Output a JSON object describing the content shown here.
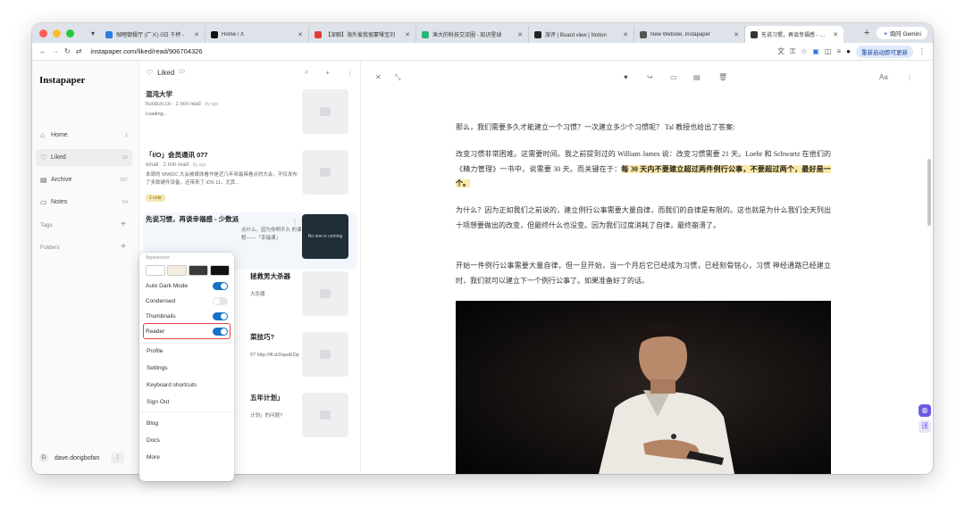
{
  "browser": {
    "tabs": [
      {
        "label": "咖哩御餐厅 (广ㄨ) 0日 千秤 -",
        "color": "#2a7de1"
      },
      {
        "label": "Home / X",
        "color": "#111111"
      },
      {
        "label": "【深聊】海外爱我很蒙嗓宝刘",
        "color": "#e23b3b"
      },
      {
        "label": "渔大的科技交流圈 - 知识星球",
        "color": "#2ab37a"
      },
      {
        "label": "旅评 | Board view | Notion",
        "color": "#222222"
      },
      {
        "label": "New Website, Instapaper",
        "color": "#555555"
      },
      {
        "label": "先说习惯，再谈幸福感 - 少数",
        "color": "#333333"
      }
    ],
    "active_tab": 6,
    "gemini_label": "询问 Gemini",
    "url": "instapaper.com/liked/read/906704326",
    "update_label": "重新启动即可更新"
  },
  "sidebar": {
    "brand": "Instapaper",
    "nav": [
      {
        "label": "Home",
        "count": "1",
        "icon": "house-icon"
      },
      {
        "label": "Liked",
        "count": "10",
        "icon": "heart-icon"
      },
      {
        "label": "Archive",
        "count": "297",
        "icon": "archive-icon"
      },
      {
        "label": "Notes",
        "count": "54",
        "icon": "notes-icon"
      }
    ],
    "tags_label": "Tags",
    "folders_label": "Folders",
    "user": "dave.dongbofan",
    "user_initial": "D"
  },
  "list": {
    "header": "Liked",
    "count": "10",
    "articles": [
      {
        "title": "混沌大学",
        "meta": "hundun.cn · 1 min read",
        "ago": "· 8y ago",
        "snippet": "Loading..."
      },
      {
        "title": "「I/O」会员通讯 077",
        "meta": "email · 2 min read",
        "ago": "· 8y ago",
        "snippet": "本周的 WWDC 大会被媒体看作是近几年来最具看点的大会，不仅发布了多款硬件设备，还带来了 iOS 11，尤其...",
        "tag": "1 note"
      },
      {
        "title": "先说习惯，再谈幸福感 - 少数派",
        "meta": "",
        "ago": "",
        "snippet": "点什么。因为你明不久 的课程——「幸福课」",
        "thumb_text": "No one is coming"
      },
      {
        "title": "拯救男大杀器",
        "meta": "",
        "ago": "",
        "snippet": "大杀器"
      },
      {
        "title": "菜技巧?",
        "meta": "",
        "ago": "",
        "snippet": "5?   http://ift.tt/2qaoEDp"
      },
      {
        "title": "五年计划」",
        "meta": "",
        "ago": "",
        "snippet": "计划」的问题?"
      }
    ],
    "last_link": "http://ift.tt/2qaoeHt"
  },
  "menu": {
    "appearance_label": "Appearance",
    "swatches": [
      "#ffffff",
      "#f3ecdf",
      "#3a3a3a",
      "#111111"
    ],
    "toggles": [
      {
        "label": "Auto Dark Mode",
        "on": true
      },
      {
        "label": "Condensed",
        "on": false
      },
      {
        "label": "Thumbnails",
        "on": true
      },
      {
        "label": "Reader",
        "on": true
      }
    ],
    "items1": [
      "Profile",
      "Settings",
      "Keyboard shortcuts",
      "Sign Out"
    ],
    "items2": [
      "Blog",
      "Docs",
      "More"
    ]
  },
  "reader": {
    "font_label": "Aa",
    "p1": "那么，我们需要多久才能建立一个习惯？一次建立多少个习惯呢？ Tal 教授也给出了答案:",
    "p2_plain": "改变习惯非常困难。这需要时间。我之前提到过的 William James 说：改变习惯需要 21 天。Loehr 和 Schwartz 在他们的《精力管理》一书中，说需要 30 天。而关键在于：",
    "p2_mark": "每 30 天内不要建立超过两件例行公事，不要超过两个，最好是一个。",
    "p3": "为什么？因为正如我们之前说的，建立例行公事需要大量自律，而我们的自律是有限的。这也就是为什么我们全天列出十项想要做出的改变，但最终什么也没变。因为我们过度消耗了自律，最终崩溃了。",
    "p4": "开始一件例行公事需要大量自律，但一旦开始，当一个月后它已经成为习惯，已经刻骨铭心，习惯 神经通路已经建立时，我们就可以建立下一个例行公事了。如果准备好了的话。"
  }
}
